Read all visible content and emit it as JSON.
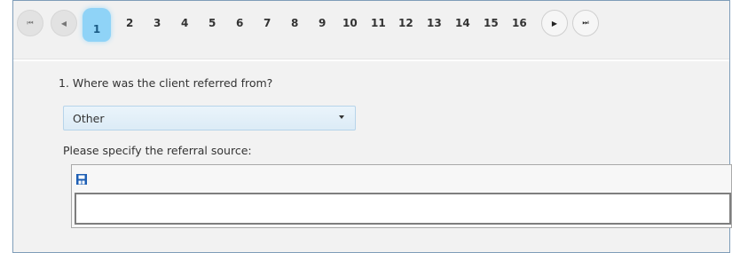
{
  "pager": {
    "first_icon": "first-page-icon",
    "prev_icon": "prev-page-icon",
    "next_icon": "next-page-icon",
    "last_icon": "last-page-icon",
    "current": "1",
    "pages": [
      "2",
      "3",
      "4",
      "5",
      "6",
      "7",
      "8",
      "9",
      "10",
      "11",
      "12",
      "13",
      "14",
      "15",
      "16"
    ]
  },
  "question": {
    "text": "1. Where was the client referred from?",
    "selected_option": "Other"
  },
  "specify": {
    "label": "Please specify the referral source:",
    "value": ""
  },
  "editor": {
    "toolbar_icon": "save-icon"
  },
  "colors": {
    "accent": "#8fd3f7",
    "frame_border": "#7f9db9",
    "select_bg": "#e3effa"
  }
}
